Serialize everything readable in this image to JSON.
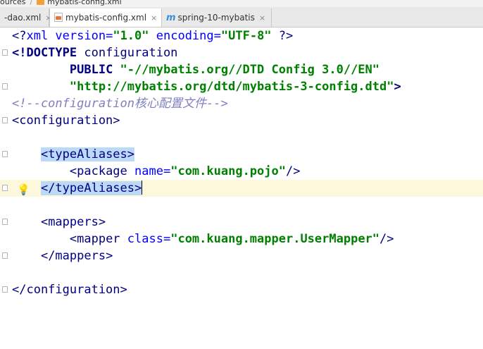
{
  "breadcrumb": {
    "items": [
      "ources",
      "mybatis-config.xml"
    ]
  },
  "tabs": [
    {
      "label": "-dao.xml",
      "icon": "xml-file-icon",
      "active": false
    },
    {
      "label": "mybatis-config.xml",
      "icon": "xml-file-icon",
      "active": true
    },
    {
      "label": "spring-10-mybatis",
      "icon": "module-m-icon",
      "active": false
    }
  ],
  "tab_close_glyph": "×",
  "code": {
    "l1_a": "<?",
    "l1_b": "xml version",
    "l1_c": "=",
    "l1_d": "\"1.0\"",
    "l1_e": " encoding",
    "l1_f": "=",
    "l1_g": "\"UTF-8\"",
    "l1_h": " ?>",
    "l2_a": "<!DOCTYPE ",
    "l2_b": "configuration",
    "l3_indent": "        ",
    "l3_a": "PUBLIC ",
    "l3_b": "\"-//mybatis.org//DTD Config 3.0//EN\"",
    "l4_indent": "        ",
    "l4_a": "\"http://mybatis.org/dtd/mybatis-3-config.dtd\"",
    "l4_b": ">",
    "l5": "<!--configuration核心配置文件-->",
    "l6": "<configuration>",
    "l8_indent": "    ",
    "l8": "<typeAliases>",
    "l9_indent": "        ",
    "l9_a": "<package ",
    "l9_b": "name",
    "l9_c": "=",
    "l9_d": "\"com.kuang.pojo\"",
    "l9_e": "/>",
    "l10_indent": "    ",
    "l10": "</typeAliases>",
    "l12_indent": "    ",
    "l12": "<mappers>",
    "l13_indent": "        ",
    "l13_a": "<mapper ",
    "l13_b": "class",
    "l13_c": "=",
    "l13_d": "\"com.kuang.mapper.UserMapper\"",
    "l13_e": "/>",
    "l14_indent": "    ",
    "l14": "</mappers>",
    "l16": "</configuration>"
  },
  "colors": {
    "tag": "#000080",
    "attribute": "#0000ff",
    "string": "#008000",
    "comment": "#8080c0",
    "current_line": "#fdf8dc",
    "tag_highlight": "#bcd9f7"
  }
}
